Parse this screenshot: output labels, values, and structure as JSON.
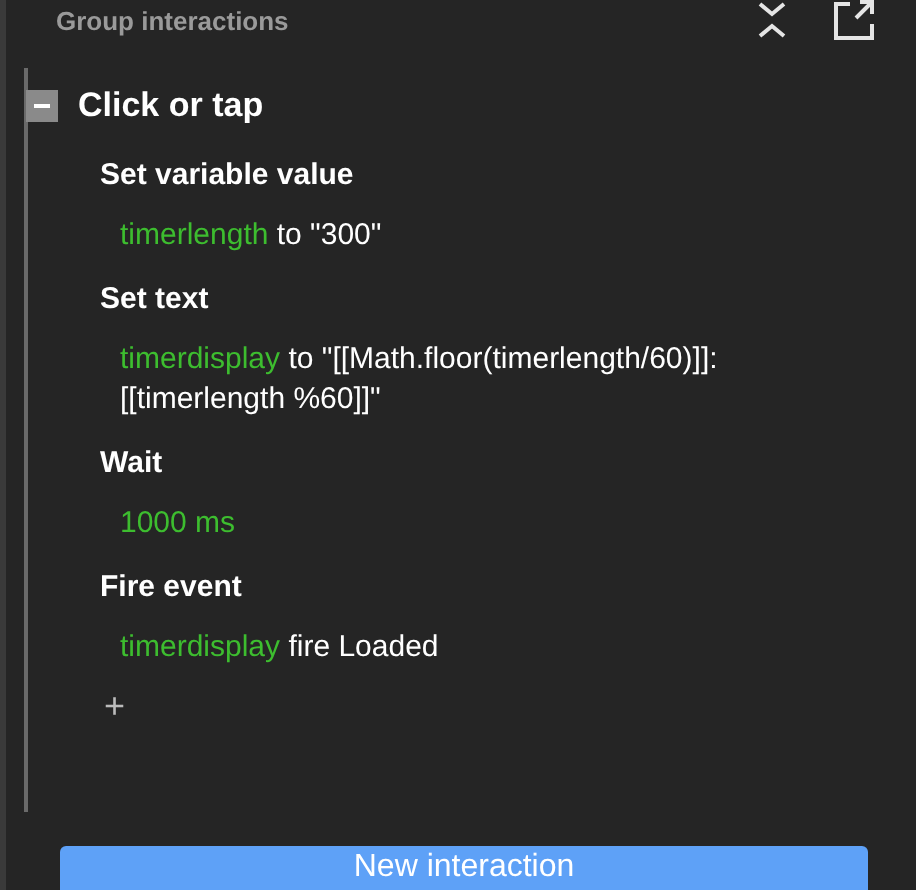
{
  "panel": {
    "title": "Group interactions"
  },
  "interaction": {
    "name": "Click or tap",
    "expanded": true,
    "actions": [
      {
        "title": "Set variable value",
        "target": "timerlength",
        "rest": "to \"300\""
      },
      {
        "title": "Set text",
        "target": "timerdisplay",
        "rest": "to \"[[Math.floor(timerlength/60)]]:[[timerlength %60]]\""
      },
      {
        "title": "Wait",
        "target": "1000 ms"
      },
      {
        "title": "Fire event",
        "target": "timerdisplay",
        "rest": "fire Loaded"
      }
    ],
    "add": "+"
  },
  "button": "New interaction"
}
